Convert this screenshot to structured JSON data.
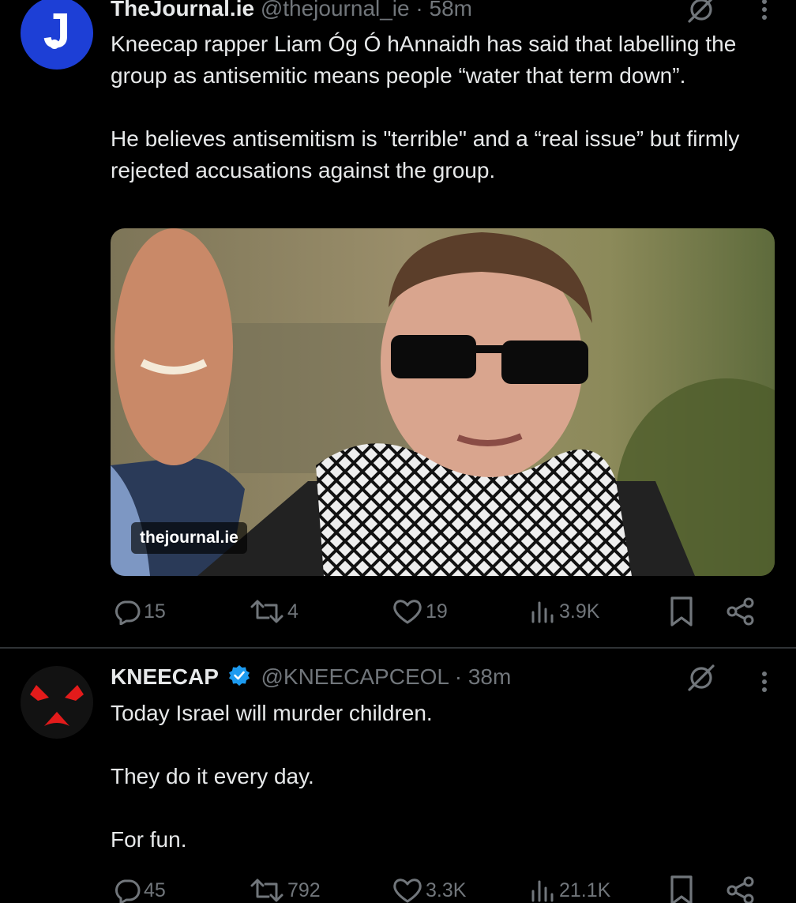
{
  "tweets": [
    {
      "author": {
        "name": "TheJournal.ie",
        "handle": "@thejournal_ie",
        "time": "58m",
        "verified": false
      },
      "separator": "·",
      "paragraphs": [
        "Kneecap rapper Liam Óg Ó hAnnaidh has said that labelling the group as antisemitic means people “water that term down”.",
        "He believes antisemitism is \"terrible\" and a “real issue” but firmly rejected accusations against the group."
      ],
      "media": {
        "badge": "thejournal.ie"
      },
      "stats": {
        "replies": "15",
        "retweets": "4",
        "likes": "19",
        "views": "3.9K"
      }
    },
    {
      "author": {
        "name": "KNEECAP",
        "handle": "@KNEECAPCEOL",
        "time": "38m",
        "verified": true
      },
      "separator": "·",
      "paragraphs": [
        "Today Israel will murder children.",
        "They do it every day.",
        "For fun."
      ],
      "stats": {
        "replies": "45",
        "retweets": "792",
        "likes": "3.3K",
        "views": "21.1K"
      }
    }
  ],
  "icons": {
    "avatar1": "thejournal-logo",
    "avatar2": "kneecap-balaclava-avatar",
    "verified": "verified-badge-icon",
    "grok": "grok-icon",
    "more": "more-dots-icon",
    "reply": "reply-icon",
    "retweet": "retweet-icon",
    "like": "heart-icon",
    "views": "views-icon",
    "bookmark": "bookmark-icon",
    "share": "share-icon"
  },
  "colors": {
    "background": "#000000",
    "text": "#e7e9ea",
    "muted": "#71767b",
    "divider": "#2f3336",
    "verified": "#1d9bf0",
    "brand_journal": "#1d3fd6",
    "kneecap_red": "#e31b1b"
  }
}
